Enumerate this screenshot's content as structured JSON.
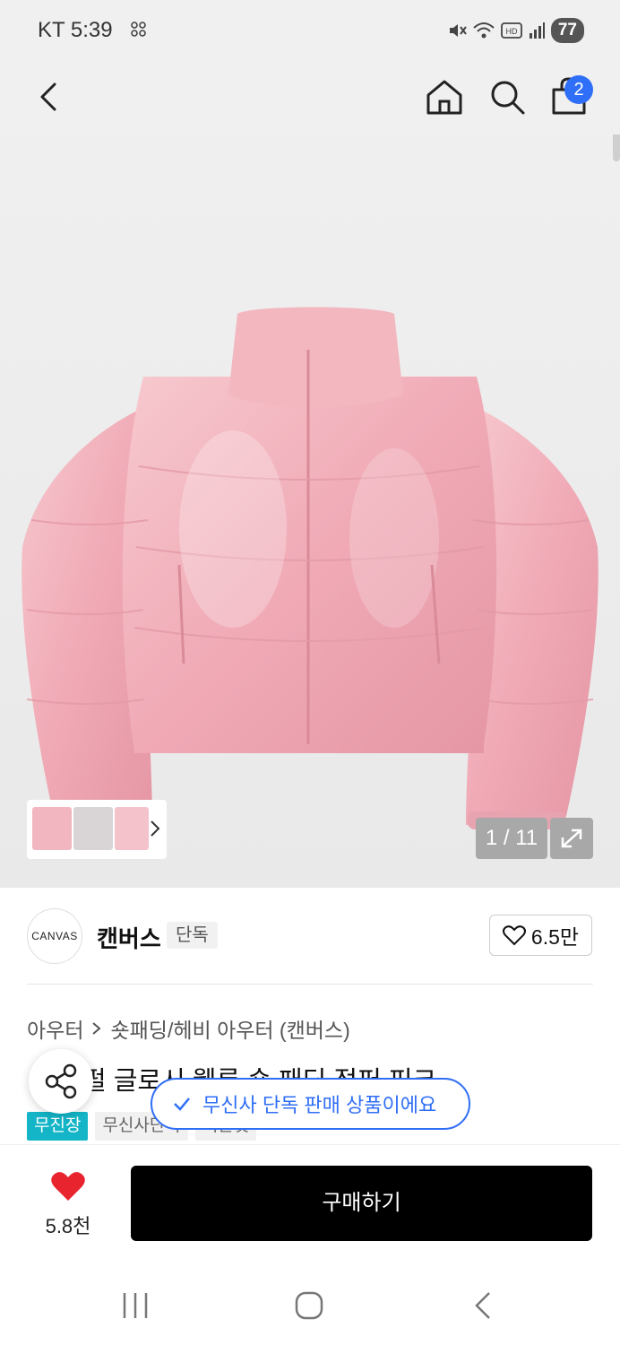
{
  "status_bar": {
    "carrier_time": "KT 5:39",
    "battery": "77"
  },
  "nav": {
    "cart_count": "2",
    "icons": [
      "back-arrow-icon",
      "home-icon",
      "search-icon",
      "shopping-bag-icon"
    ]
  },
  "gallery": {
    "counter": "1 / 11",
    "product_color": "#f3b3bd"
  },
  "brand": {
    "logo_text": "CANVAS",
    "name": "캔버스",
    "tag": "단독",
    "likes": "6.5만"
  },
  "breadcrumb": {
    "items": [
      "아우터",
      "숏패딩/헤비 아우터 (캔버스)"
    ]
  },
  "product": {
    "title_visible": "펄 글로시 웰론 숏 패딩 점퍼 피크",
    "chips": [
      "무진장",
      "무신사단독",
      "기본핏"
    ]
  },
  "toast": {
    "message": "무신사 단독 판매 상품이에요"
  },
  "bottom": {
    "likes": "5.8천",
    "buy_label": "구매하기"
  },
  "colors": {
    "accent_blue": "#2f6ef6",
    "teal": "#13b5c7",
    "heart_red": "#e8242f"
  }
}
